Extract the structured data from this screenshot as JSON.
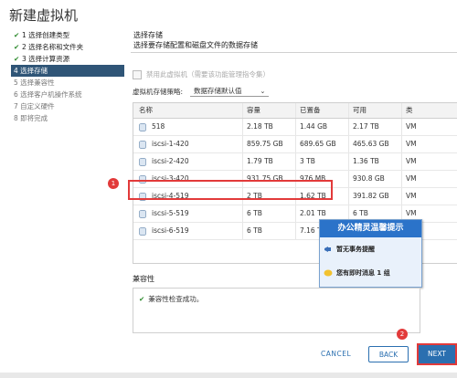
{
  "window": {
    "title": "新建虚拟机"
  },
  "steps": [
    {
      "label": "1 选择创建类型",
      "state": "done"
    },
    {
      "label": "2 选择名称和文件夹",
      "state": "done"
    },
    {
      "label": "3 选择计算资源",
      "state": "done"
    },
    {
      "label": "4 选择存储",
      "state": "current"
    },
    {
      "label": "5 选择兼容性",
      "state": "pending"
    },
    {
      "label": "6 选择客户机操作系统",
      "state": "pending"
    },
    {
      "label": "7 自定义硬件",
      "state": "pending"
    },
    {
      "label": "8 即将完成",
      "state": "pending"
    }
  ],
  "header": {
    "title": "选择存储",
    "subtitle": "选择要存储配置和磁盘文件的数据存储"
  },
  "disable_sdrs": {
    "label": "禁用此虚拟机（需要该功能管理指令集）"
  },
  "policy": {
    "label": "虚拟机存储策略:",
    "value": "数据存储默认值"
  },
  "table": {
    "headers": [
      "名称",
      "容量",
      "已置备",
      "可用",
      "类"
    ],
    "rows": [
      {
        "name": "518",
        "capacity": "2.18 TB",
        "provisioned": "1.44 GB",
        "free": "2.17 TB",
        "type": "VM"
      },
      {
        "name": "iscsi-1-420",
        "capacity": "859.75 GB",
        "provisioned": "689.65 GB",
        "free": "465.63 GB",
        "type": "VM"
      },
      {
        "name": "iscsi-2-420",
        "capacity": "1.79 TB",
        "provisioned": "3 TB",
        "free": "1.36 TB",
        "type": "VM"
      },
      {
        "name": "iscsi-3-420",
        "capacity": "931.75 GB",
        "provisioned": "976 MB",
        "free": "930.8 GB",
        "type": "VM"
      },
      {
        "name": "iscsi-4-519",
        "capacity": "2 TB",
        "provisioned": "1.62 TB",
        "free": "391.82 GB",
        "type": "VM"
      },
      {
        "name": "iscsi-5-519",
        "capacity": "6 TB",
        "provisioned": "2.01 TB",
        "free": "6 TB",
        "type": "VM"
      },
      {
        "name": "iscsi-6-519",
        "capacity": "6 TB",
        "provisioned": "7.16 T",
        "free": "",
        "type": ""
      }
    ]
  },
  "annotations": {
    "badge1": "1",
    "badge2": "2"
  },
  "popup": {
    "title": "办公精灵温馨提示",
    "line1": "暂无事务提醒",
    "line2": "您有即时消息 1 组"
  },
  "compat": {
    "label": "兼容性",
    "message": "兼容性检查成功。"
  },
  "footer": {
    "cancel": "CANCEL",
    "back": "BACK",
    "next": "NEXT"
  },
  "colors": {
    "accent": "#2a6fb0",
    "current_step": "#2f5577",
    "highlight": "#e23a3a",
    "check": "#2e8b2e"
  }
}
